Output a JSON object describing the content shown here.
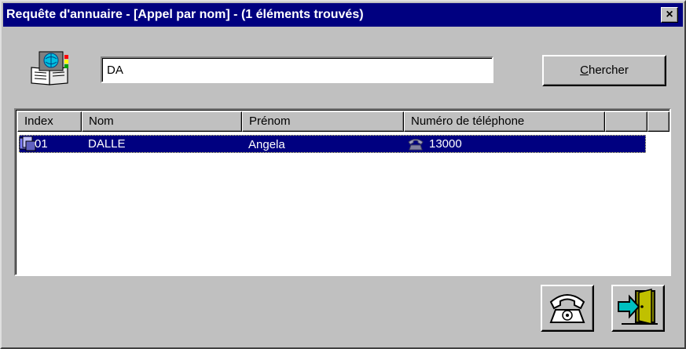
{
  "window": {
    "title": "Requête d'annuaire - [Appel par nom] - (1 éléments trouvés)",
    "close_glyph": "×"
  },
  "search": {
    "value": "DA",
    "button_label_accel": "C",
    "button_label_rest": "hercher",
    "icon": "directory-book-icon"
  },
  "table": {
    "columns": [
      "Index",
      "Nom",
      "Prénom",
      "Numéro de téléphone",
      ""
    ],
    "rows": [
      {
        "index": "01",
        "nom": "DALLE",
        "prenom": "Angela",
        "telephone": "13000",
        "row_icon": "contact-card-icon",
        "phone_icon": "phone-icon"
      }
    ]
  },
  "buttons": {
    "call_icon": "telephone-icon",
    "exit_icon": "exit-door-icon"
  },
  "colors": {
    "title_bar": "#000080",
    "selection": "#000080",
    "face": "#c0c0c0"
  }
}
